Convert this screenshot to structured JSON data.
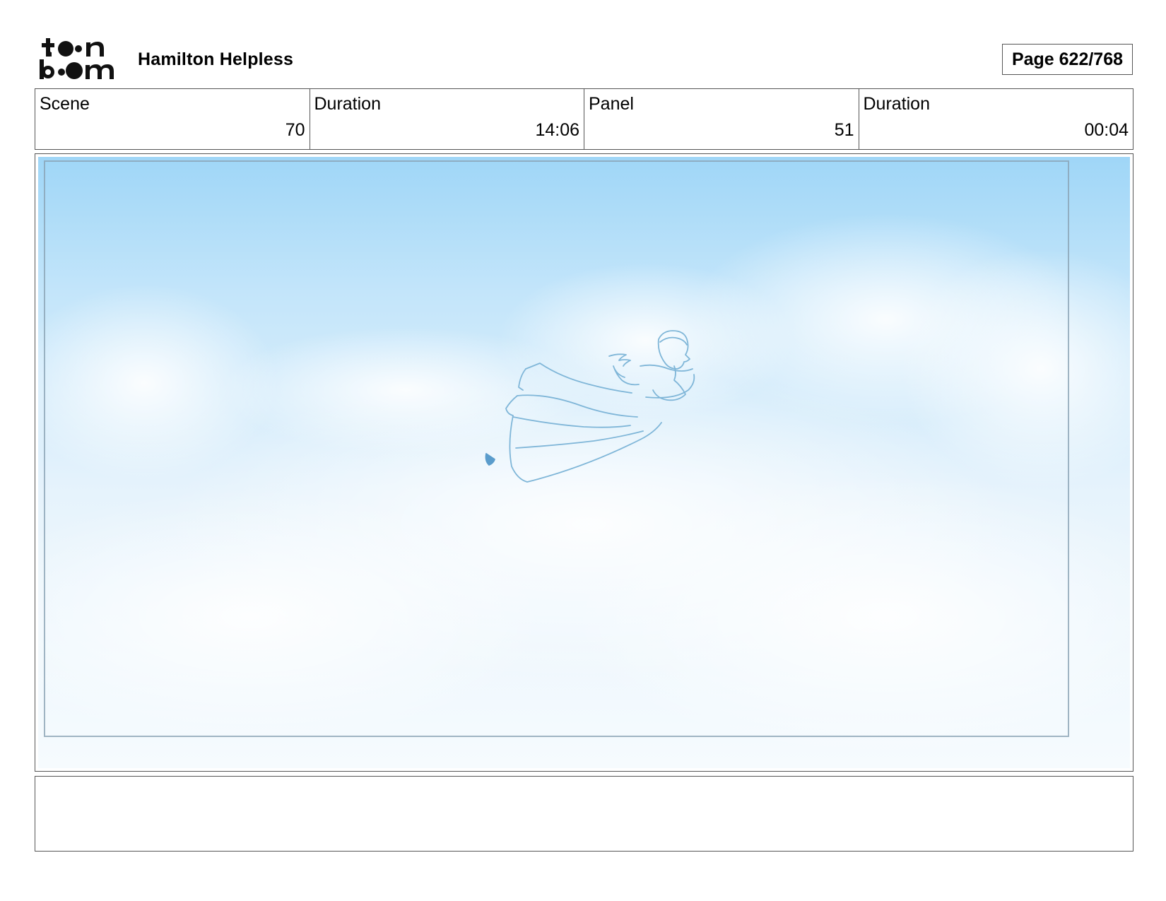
{
  "header": {
    "logo_text_top": "toon",
    "logo_text_bottom": "boom",
    "project_title": "Hamilton Helpless",
    "page_indicator": "Page 622/768"
  },
  "info": {
    "scene_label": "Scene",
    "scene_value": "70",
    "scene_duration_label": "Duration",
    "scene_duration_value": "14:06",
    "panel_label": "Panel",
    "panel_value": "51",
    "panel_duration_label": "Duration",
    "panel_duration_value": "00:04"
  },
  "panel": {
    "sky_color_top": "#9fd6f7",
    "sky_color_bottom": "#f4f9fd",
    "sketch_color": "#7fb6d8"
  },
  "notes": {
    "text": ""
  }
}
